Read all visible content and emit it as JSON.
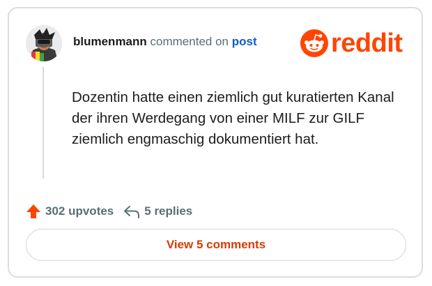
{
  "comment_card": {
    "author": "blumenmann",
    "action_text": "commented on",
    "post_link": "post",
    "brand": "reddit",
    "body": "Dozentin hatte einen ziemlich gut kuratierten Kanal der ihren Werdegang von einer MILF zur GILF ziemlich engmaschig dokumentiert hat.",
    "upvotes": "302 upvotes",
    "replies": "5 replies",
    "view_comments": "View 5 comments"
  },
  "colors": {
    "brand_orange": "#ff4500",
    "link_blue": "#0b5ec9",
    "muted_text": "#576f76",
    "button_text": "#d93a00"
  },
  "icons": {
    "brand": "reddit-snoo-icon",
    "upvote": "upvote-arrow-icon",
    "reply": "reply-arrow-icon"
  }
}
